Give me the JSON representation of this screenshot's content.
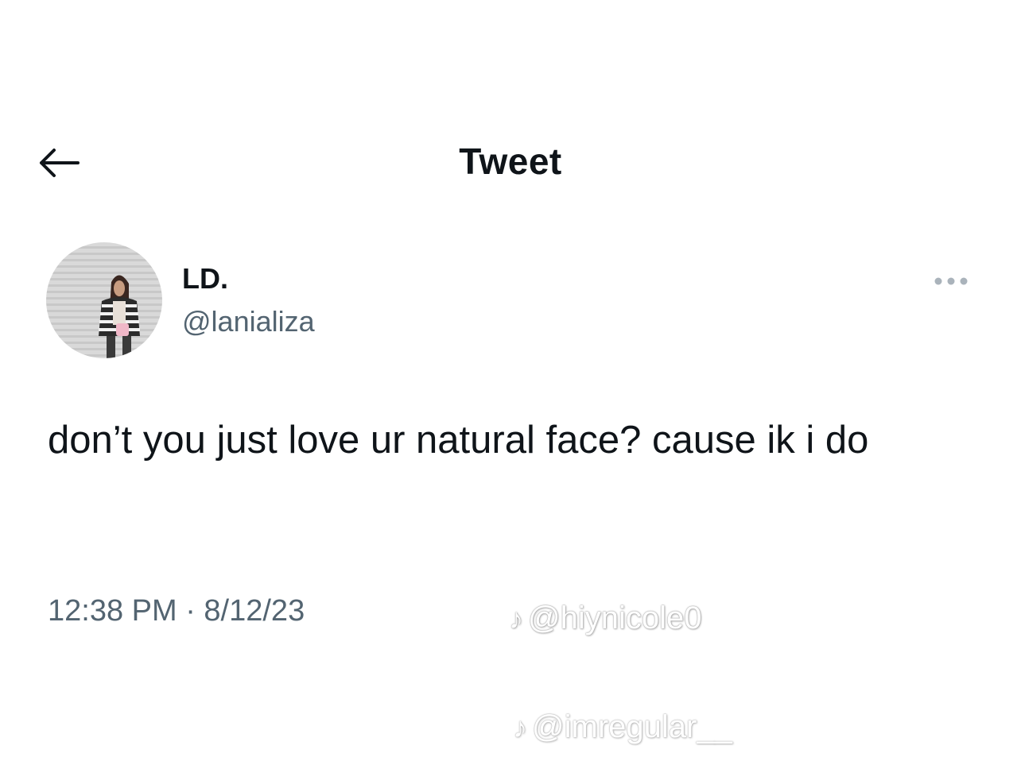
{
  "header": {
    "title": "Tweet"
  },
  "tweet": {
    "author_name": "LD.",
    "author_handle": "@lanializa",
    "text": "don’t you just love ur natural face? cause ik i do",
    "timestamp": "12:38 PM · 8/12/23"
  },
  "watermarks": {
    "first": "@hiynicole0",
    "second": "@imregular__"
  },
  "icons": {
    "back": "arrow-left-icon",
    "more": "more-dots-icon",
    "watermark": "tiktok-icon"
  },
  "colors": {
    "text_primary": "#0f1419",
    "text_secondary": "#536471",
    "background": "#ffffff"
  }
}
